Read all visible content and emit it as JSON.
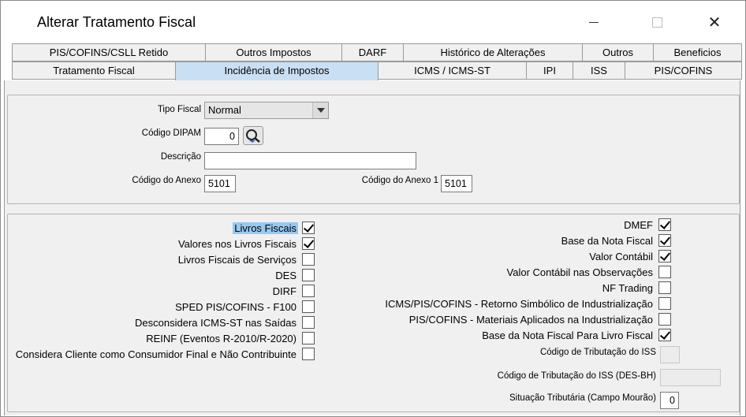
{
  "window": {
    "title": "Alterar Tratamento Fiscal"
  },
  "tabs_row1": [
    {
      "label": "PIS/COFINS/CSLL Retido"
    },
    {
      "label": "Outros Impostos"
    },
    {
      "label": "DARF"
    },
    {
      "label": "Histórico de Alterações"
    },
    {
      "label": "Outros"
    },
    {
      "label": "Beneficios"
    }
  ],
  "tabs_row2": [
    {
      "label": "Tratamento Fiscal"
    },
    {
      "label": "Incidência de Impostos",
      "active": true
    },
    {
      "label": "ICMS / ICMS-ST"
    },
    {
      "label": "IPI"
    },
    {
      "label": "ISS"
    },
    {
      "label": "PIS/COFINS"
    }
  ],
  "form": {
    "tipo_fiscal_label": "Tipo Fiscal",
    "tipo_fiscal_value": "Normal",
    "codigo_dipam_label": "Código DIPAM",
    "codigo_dipam_value": "0",
    "descricao_label": "Descrição",
    "descricao_value": "",
    "codigo_anexo_label": "Código do Anexo",
    "codigo_anexo_value": "5101",
    "codigo_anexo1_label": "Código do Anexo 1",
    "codigo_anexo1_value": "5101"
  },
  "left_checks": [
    {
      "label": "Livros Fiscais",
      "checked": true
    },
    {
      "label": "Valores nos Livros Fiscais",
      "checked": true
    },
    {
      "label": "Livros Fiscais de Serviços",
      "checked": false
    },
    {
      "label": "DES",
      "checked": false
    },
    {
      "label": "DIRF",
      "checked": false
    },
    {
      "label": "SPED PIS/COFINS - F100",
      "checked": false
    },
    {
      "label": "Desconsidera ICMS-ST nas Saídas",
      "checked": false
    },
    {
      "label": "REINF (Eventos R-2010/R-2020)",
      "checked": false
    },
    {
      "label": "Considera Cliente como Consumidor Final e Não Contribuinte",
      "checked": false
    }
  ],
  "right_checks": [
    {
      "label": "DMEF",
      "checked": true
    },
    {
      "label": "Base da Nota Fiscal",
      "checked": true
    },
    {
      "label": "Valor Contábil",
      "checked": true
    },
    {
      "label": "Valor Contábil nas Observações",
      "checked": false
    },
    {
      "label": "NF Trading",
      "checked": false
    },
    {
      "label": "ICMS/PIS/COFINS - Retorno Simbólico de Industrialização",
      "checked": false
    },
    {
      "label": "PIS/COFINS - Materiais Aplicados na Industrialização",
      "checked": false
    },
    {
      "label": "Base da Nota Fiscal Para Livro Fiscal",
      "checked": true
    }
  ],
  "right_fields": {
    "codigo_iss_label": "Código de Tributação do ISS",
    "codigo_iss_value": "",
    "codigo_iss_desbh_label": "Código de Tributação do ISS (DES-BH)",
    "codigo_iss_desbh_value": "",
    "situacao_label": "Situação Tributária (Campo Mourão)",
    "situacao_value": "0"
  }
}
